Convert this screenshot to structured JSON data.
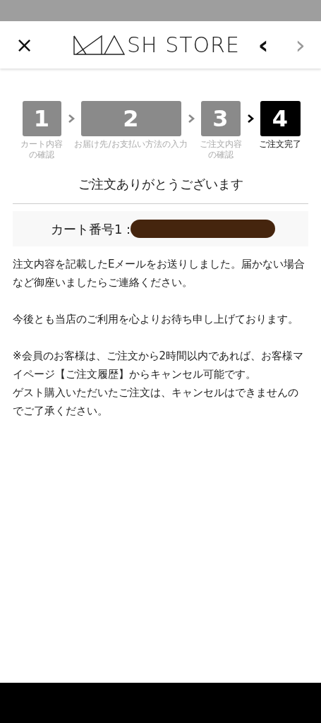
{
  "header": {
    "close": "×",
    "logo_text": "SH STORE",
    "back": "‹",
    "forward": "›"
  },
  "steps": [
    {
      "number": "1",
      "label_lines": [
        "カート内容",
        "の確認"
      ],
      "selected": false
    },
    {
      "number": "2",
      "label_lines": [
        "お届け先/お支払い方法の入力"
      ],
      "selected": false
    },
    {
      "number": "3",
      "label_lines": [
        "ご注文内容",
        "の確認"
      ],
      "selected": false
    },
    {
      "number": "4",
      "label_lines": [
        "ご注文完了"
      ],
      "selected": true
    }
  ],
  "title": "ご注文ありがとうございます",
  "cart_number": {
    "label": "カート番号1：",
    "redacted": true
  },
  "paragraphs": [
    [
      "注文内容を記載したEメールをお送りしました。届かない場合など御座いましたらご連絡ください。"
    ],
    [
      "今後とも当店のご利用を心よりお待ち申し上げております。"
    ],
    [
      "※会員のお客様は、ご注文から2時間以内であれば、お客様マイページ【ご注文履歴】からキャンセル可能です。",
      "ゲスト購入いただいたご注文は、キャンセルはできませんのでご了承ください。"
    ]
  ]
}
